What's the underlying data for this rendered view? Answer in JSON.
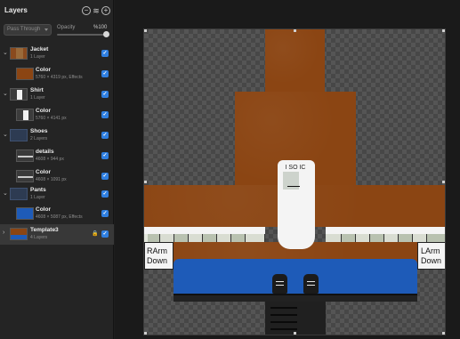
{
  "panel": {
    "title": "Layers",
    "blend_mode": "Pass Through",
    "opacity_label": "Opacity",
    "opacity_value": "%100",
    "opacity_fraction": 1.0
  },
  "layers": [
    {
      "name": "Jacket",
      "sub": "1 Layer"
    },
    {
      "name": "Color",
      "sub": "5760 × 4319 px, Effects"
    },
    {
      "name": "Shirt",
      "sub": "1 Layer"
    },
    {
      "name": "Color",
      "sub": "5760 × 4141 px"
    },
    {
      "name": "Shoes",
      "sub": "2 Layers"
    },
    {
      "name": "details",
      "sub": "4608 × 944 px"
    },
    {
      "name": "Color",
      "sub": "4608 × 1091 px"
    },
    {
      "name": "Pants",
      "sub": "1 Layer"
    },
    {
      "name": "Color",
      "sub": "4608 × 5087 px, Effects"
    },
    {
      "name": "Template3",
      "sub": "4 Layers"
    }
  ],
  "canvas": {
    "left_arm_label_1": "RArm",
    "left_arm_label_2": "Down",
    "right_arm_label_1": "LArm",
    "right_arm_label_2": "Down",
    "face_text": "I SO IC"
  },
  "colors": {
    "accent": "#2f7fe0",
    "jacket": "#8b4513",
    "pants": "#1e5bb8"
  },
  "icons": {
    "minus": "remove-layer-icon",
    "stack": "layers-stack-icon",
    "plus": "add-layer-icon",
    "check": "checkmark-icon",
    "lock": "lock-icon"
  }
}
